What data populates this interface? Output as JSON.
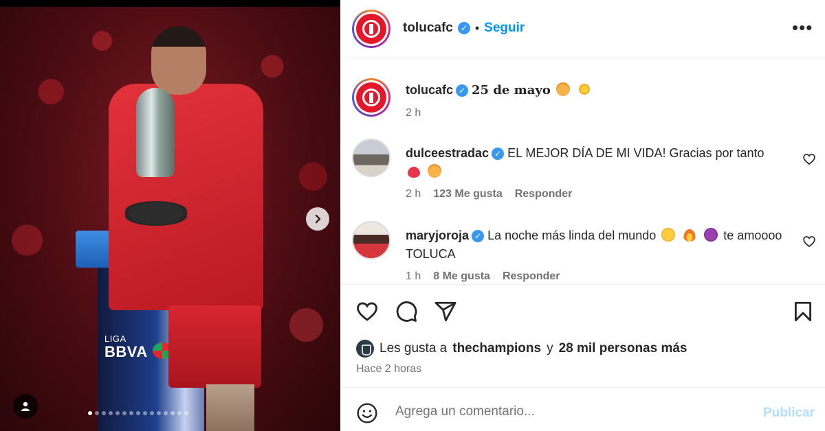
{
  "header": {
    "username": "tolucafc",
    "separator": "•",
    "follow_label": "Seguir",
    "more_label": "•••"
  },
  "caption": {
    "username": "tolucafc",
    "text": "25 de mayo",
    "time": "2 h"
  },
  "comments": [
    {
      "username": "dulceestradac",
      "text": "EL MEJOR DÍA DE MI VIDA! Gracias por tanto",
      "time": "2 h",
      "likes": "123 Me gusta",
      "reply_label": "Responder"
    },
    {
      "username": "maryjoroja",
      "text_before": "La noche más linda del mundo",
      "text_after": "te amoooo TOLUCA",
      "time": "1 h",
      "likes": "8 Me gusta",
      "reply_label": "Responder"
    }
  ],
  "likes": {
    "prefix": "Les gusta a",
    "user": "thechampions",
    "connector": "y",
    "others": "28 mil personas más"
  },
  "posted_time": "Hace 2 horas",
  "add_comment": {
    "placeholder": "Agrega un comentario...",
    "publish_label": "Publicar"
  },
  "media": {
    "liga_label": "LIGA",
    "sponsor_label": "BBVA",
    "carousel_total": 15,
    "carousel_active": 0
  },
  "colors": {
    "accent": "#0095f6",
    "verified": "#3897f0",
    "club_red": "#e3182a",
    "publish_disabled": "#b2dffc"
  }
}
